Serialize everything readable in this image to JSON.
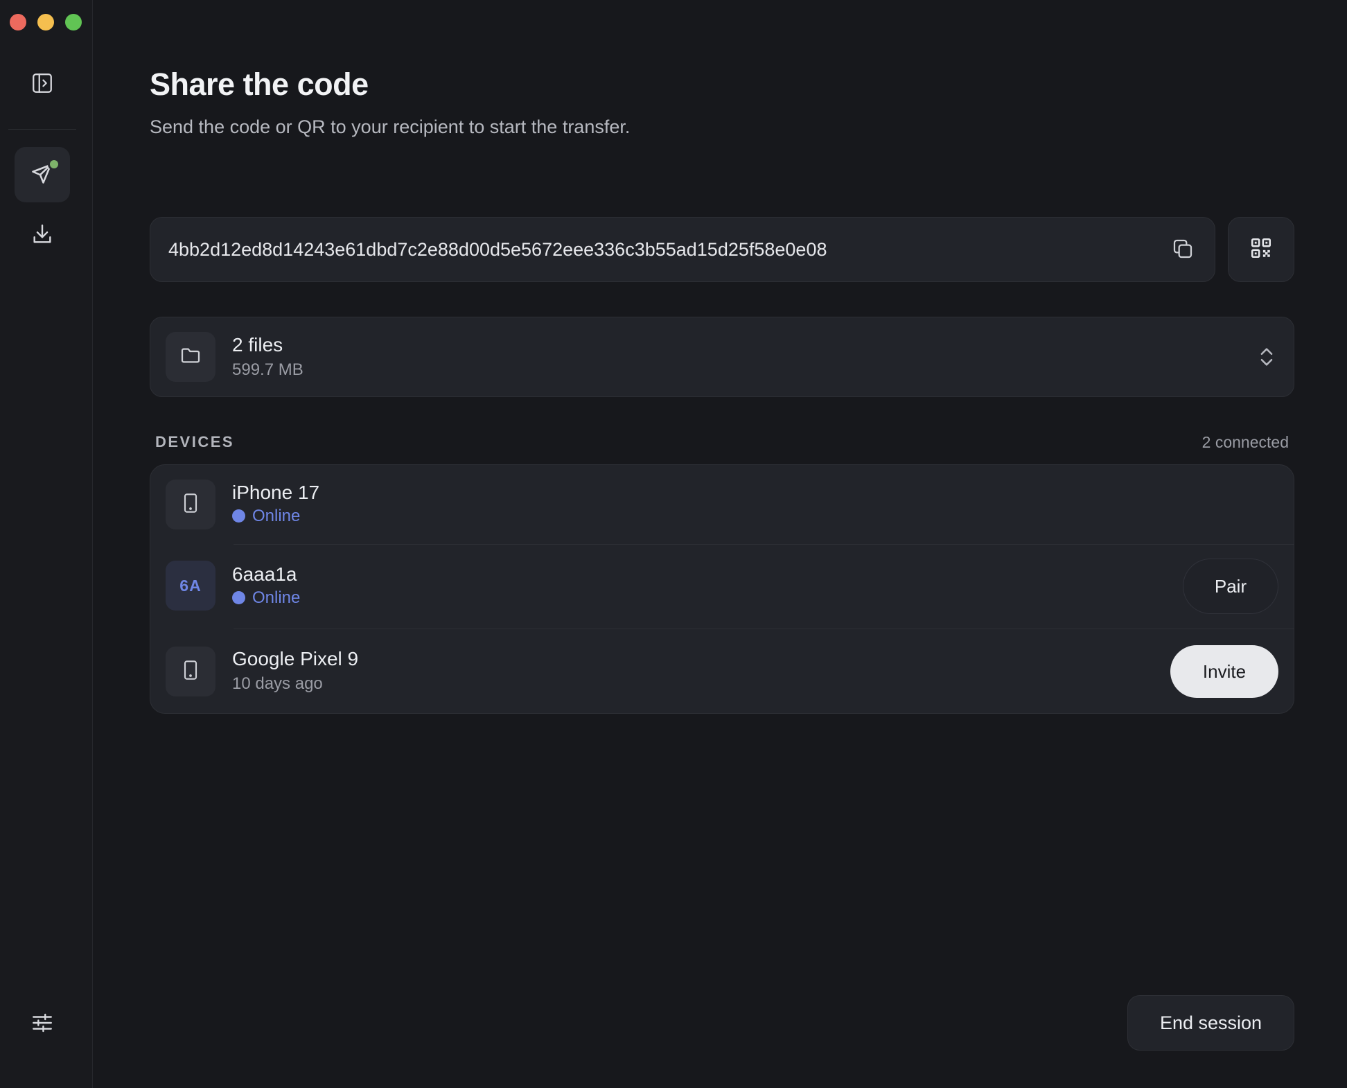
{
  "header": {
    "title": "Share the code",
    "subtitle": "Send the code or QR to your recipient to start the transfer."
  },
  "sidebar": {
    "items": [
      {
        "icon": "sidebar-toggle-icon"
      },
      {
        "icon": "send-icon",
        "active": true,
        "notification": true
      },
      {
        "icon": "download-icon"
      },
      {
        "icon": "settings-sliders-icon"
      }
    ]
  },
  "code": {
    "value": "4bb2d12ed8d14243e61dbd7c2e88d00d5e5672eee336c3b55ad15d25f58e0e08",
    "copy_icon": "copy-icon",
    "qr_icon": "qr-code-icon"
  },
  "files": {
    "count_label": "2 files",
    "size_label": "599.7 MB",
    "icon": "folder-icon"
  },
  "devices": {
    "section_label": "DEVICES",
    "connected_label": "2 connected",
    "items": [
      {
        "name": "iPhone 17",
        "status": "Online",
        "icon": "phone-icon"
      },
      {
        "name": "6aaa1a",
        "status": "Online",
        "avatar": "6A",
        "action": "Pair"
      },
      {
        "name": "Google Pixel 9",
        "status": "10 days ago",
        "icon": "phone-icon",
        "action": "Invite"
      }
    ]
  },
  "footer": {
    "end_session_label": "End session"
  },
  "colors": {
    "background": "#17181c",
    "card": "#22242a",
    "accent": "#6f86e6",
    "notification": "#7eb36a"
  }
}
